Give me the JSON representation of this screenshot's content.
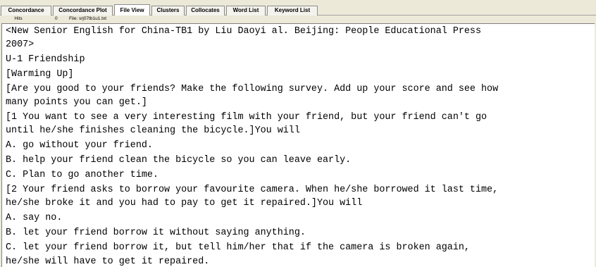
{
  "tabs": [
    {
      "label": "Concordance",
      "active": false
    },
    {
      "label": "Concordance Plot",
      "active": false
    },
    {
      "label": "File View",
      "active": true
    },
    {
      "label": "Clusters",
      "active": false
    },
    {
      "label": "Collocates",
      "active": false
    },
    {
      "label": "Word List",
      "active": false
    },
    {
      "label": "Keyword List",
      "active": false
    }
  ],
  "status": {
    "hits_label": "Hits",
    "hits_value": "0",
    "file_label": "File:",
    "file_value": "srj07tb1u1.txt"
  },
  "file_text": [
    "<New Senior English for China-TB1 by Liu Daoyi al. Beijing: People Educational Press",
    "2007>",
    "U-1 Friendship",
    "[Warming Up]",
    "[Are you good to your friends? Make the following survey. Add up your score and see how",
    "many points you can get.]",
    "[1 You want to see a very interesting film with your friend, but your friend can't go",
    "until he/she finishes cleaning the bicycle.]You will",
    "A. go without your friend.",
    "B. help your friend clean the bicycle so you can leave early.",
    "C. Plan to go another time.",
    "[2 Your friend asks to borrow your favourite camera. When he/she borrowed it last time,",
    "he/she broke it and you had to pay to get it repaired.]You will",
    "A. say no.",
    "B. let your friend borrow it without saying anything.",
    "C. let your friend borrow it, but tell him/her that if the camera is broken again,",
    "he/she will have to get it repaired."
  ]
}
